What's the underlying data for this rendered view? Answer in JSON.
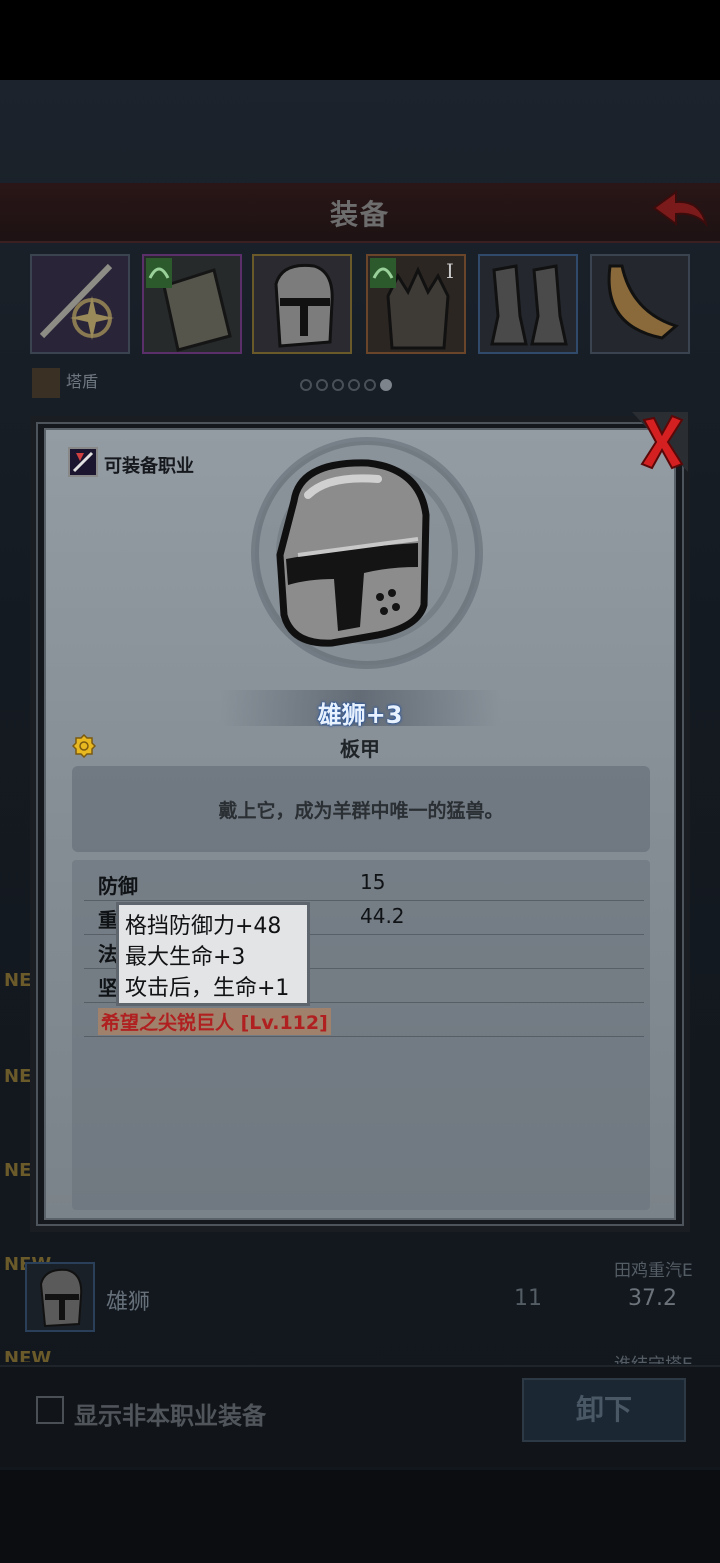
{
  "header": {
    "title": "装备"
  },
  "equipment_slots": [
    {
      "icon": "crossed-swords-emblem-icon",
      "frame": "default"
    },
    {
      "icon": "tower-shield-icon",
      "frame": "purple"
    },
    {
      "icon": "great-helm-icon",
      "frame": "gold"
    },
    {
      "icon": "spiked-armor-icon",
      "frame": "orange",
      "badge": "I"
    },
    {
      "icon": "armored-boots-icon",
      "frame": "blue"
    },
    {
      "icon": "horn-icon",
      "frame": "default"
    }
  ],
  "sub_tab": {
    "label": "塔盾"
  },
  "page_dots": {
    "count": 6,
    "active": 6
  },
  "popup": {
    "class_label": "可装备职业",
    "item_name": "雄狮+3",
    "item_type": "板甲",
    "description": "戴上它，成为羊群中唯一的猛兽。",
    "stats": [
      {
        "label": "防御",
        "value": "15"
      },
      {
        "label": "重",
        "value": "44.2"
      },
      {
        "label": "法",
        "value": ""
      },
      {
        "label": "坚",
        "value": ""
      }
    ],
    "set_bonus": "希望之尖锐巨人 [Lv.112]",
    "tooltip_lines": [
      "格挡防御力+48",
      "最大生命+3",
      "攻击后，生命+1"
    ]
  },
  "background_list": {
    "new_tags": [
      "NEW",
      "NEW",
      "NEW",
      "NEW",
      "NEW"
    ],
    "row": {
      "name": "雄狮",
      "col1": "11",
      "col2": "37.2",
      "subtitle": "田鸡重汽E"
    },
    "next_subtitle": "谁结守塔E"
  },
  "footer": {
    "checkbox_label": "显示非本职业装备",
    "unequip_label": "卸下"
  },
  "colors": {
    "name_glow": "#2b5fb0",
    "set_bonus_red": "#b02020",
    "close_red": "#d42020"
  }
}
